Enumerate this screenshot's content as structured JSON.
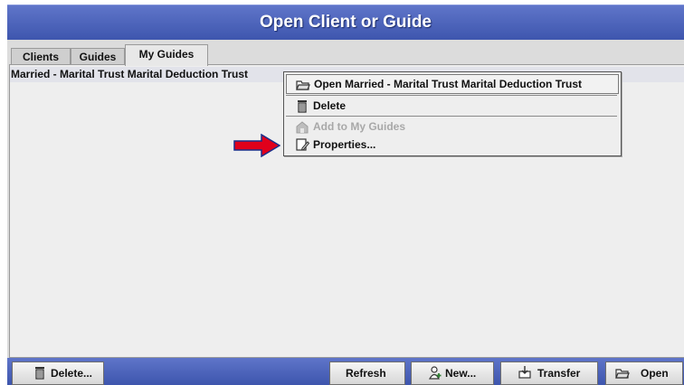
{
  "window": {
    "title": "Open Client or Guide"
  },
  "tabs": [
    {
      "label": "Clients"
    },
    {
      "label": "Guides"
    },
    {
      "label": "My Guides"
    }
  ],
  "list": {
    "items": [
      {
        "label": "Married - Marital Trust Marital Deduction Trust"
      }
    ]
  },
  "context_menu": {
    "open_label": "Open Married - Marital Trust Marital Deduction Trust",
    "delete_label": "Delete",
    "add_label": "Add to My Guides",
    "properties_label": "Properties..."
  },
  "footer": {
    "delete_label": "Delete...",
    "refresh_label": "Refresh",
    "new_label": "New...",
    "transfer_label": "Transfer",
    "open_label": "Open"
  },
  "colors": {
    "titlebar": "#4a62bd",
    "arrow": "#e0001b",
    "selection": "#e2e3ea"
  },
  "icons": [
    "folder-open-icon",
    "trash-icon",
    "add-guide-icon",
    "properties-icon",
    "new-user-icon",
    "transfer-icon",
    "red-arrow-icon"
  ]
}
